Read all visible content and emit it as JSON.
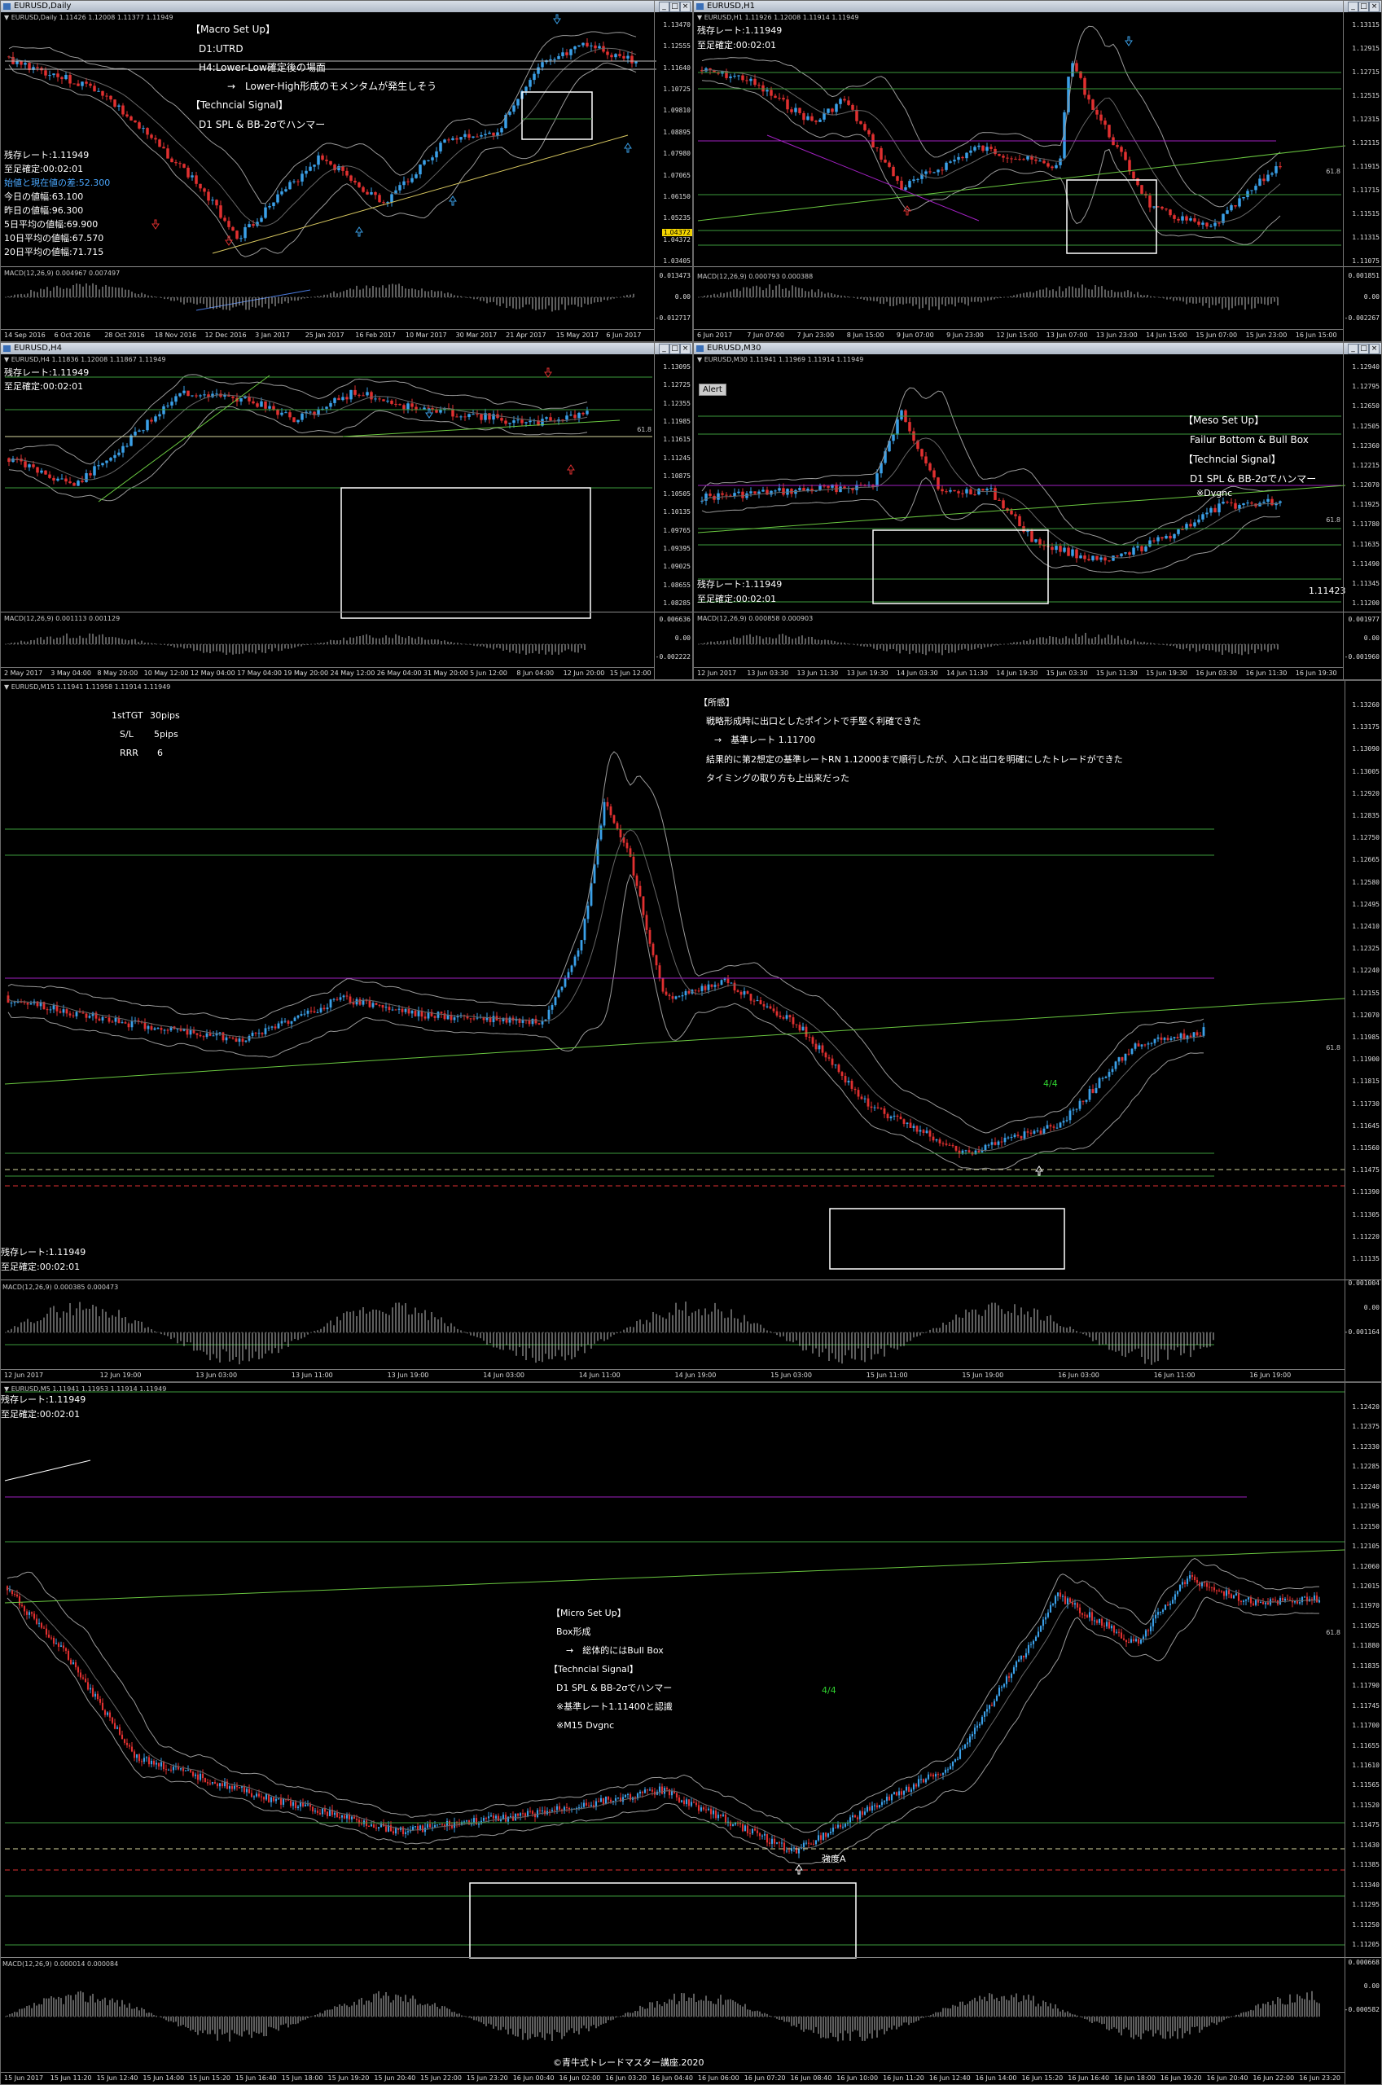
{
  "windows": {
    "daily": {
      "title": "EURUSD,Daily",
      "symbol_line": "▼ EURUSD,Daily  1.11426 1.12008 1.11377 1.11949",
      "annotations": [
        "【Macro Set Up】",
        "D1:UTRD",
        "H4:Lower-Low確定後の場面",
        "→　Lower-High形成のモメンタムが発生しそう",
        "【Techncial Signal】",
        "D1 SPL & BB-2σでハンマー"
      ],
      "info": [
        "残存レート:1.11949",
        "至足確定:00:02:01",
        "始値と現在値の差:52.300",
        "今日の値幅:63.100",
        "昨日の値幅:96.300",
        "5日平均の値幅:69.900",
        "10日平均の値幅:67.570",
        "20日平均の値幅:71.715"
      ],
      "macd_label": "MACD(12,26,9) 0.004967 0.007497",
      "price_ticks": [
        "1.13470",
        "1.12555",
        "1.11640",
        "1.10725",
        "1.09810",
        "1.08895",
        "1.07980",
        "1.07065",
        "1.06150",
        "1.05235",
        "1.04372",
        "1.03405"
      ],
      "price_badge": "1.04372",
      "macd_ticks": [
        "0.013473",
        "0.00",
        "-0.012717"
      ],
      "x_ticks": [
        "14 Sep 2016",
        "6 Oct 2016",
        "28 Oct 2016",
        "18 Nov 2016",
        "12 Dec 2016",
        "3 Jan 2017",
        "25 Jan 2017",
        "16 Feb 2017",
        "10 Mar 2017",
        "30 Mar 2017",
        "21 Apr 2017",
        "15 May 2017",
        "6 Jun 2017"
      ]
    },
    "h1": {
      "title": "EURUSD,H1",
      "symbol_line": "▼ EURUSD,H1  1.11926 1.12008 1.11914 1.11949",
      "info": [
        "残存レート:1.11949",
        "至足確定:00:02:01"
      ],
      "macd_label": "MACD(12,26,9) 0.000793 0.000388",
      "price_ticks": [
        "1.13115",
        "1.12915",
        "1.12715",
        "1.12515",
        "1.12315",
        "1.12115",
        "1.11915",
        "1.11715",
        "1.11515",
        "1.11315",
        "1.11075"
      ],
      "fib_label": "61.8",
      "macd_ticks": [
        "0.001851",
        "0.00",
        "-0.002267"
      ],
      "x_ticks": [
        "6 Jun 2017",
        "7 Jun 07:00",
        "7 Jun 23:00",
        "8 Jun 15:00",
        "9 Jun 07:00",
        "9 Jun 23:00",
        "12 Jun 15:00",
        "13 Jun 07:00",
        "13 Jun 23:00",
        "14 Jun 15:00",
        "15 Jun 07:00",
        "15 Jun 23:00",
        "16 Jun 15:00"
      ]
    },
    "h4": {
      "title": "EURUSD,H4",
      "symbol_line": "▼ EURUSD,H4  1.11836 1.12008 1.11867 1.11949",
      "info": [
        "残存レート:1.11949",
        "至足確定:00:02:01"
      ],
      "macd_label": "MACD(12,26,9) 0.001113 0.001129",
      "price_ticks": [
        "1.13095",
        "1.12725",
        "1.12355",
        "1.11985",
        "1.11615",
        "1.11245",
        "1.10875",
        "1.10505",
        "1.10135",
        "1.09765",
        "1.09395",
        "1.09025",
        "1.08655",
        "1.08285"
      ],
      "fib_label": "61.8",
      "macd_ticks": [
        "0.006636",
        "0.00",
        "-0.002222"
      ],
      "x_ticks": [
        "2 May 2017",
        "3 May 04:00",
        "8 May 20:00",
        "10 May 12:00",
        "12 May 04:00",
        "17 May 04:00",
        "19 May 20:00",
        "24 May 12:00",
        "26 May 04:00",
        "31 May 20:00",
        "5 Jun 12:00",
        "8 Jun 04:00",
        "12 Jun 20:00",
        "15 Jun 12:00"
      ]
    },
    "m30": {
      "title": "EURUSD,M30",
      "symbol_line": "▼ EURUSD,M30  1.11941 1.11969 1.11914 1.11949",
      "alert": "Alert",
      "annotations": [
        "【Meso Set Up】",
        "Failur Bottom & Bull Box",
        "【Techncial Signal】",
        "D1 SPL & BB-2σでハンマー",
        "※Dvgnc"
      ],
      "info": [
        "残存レート:1.11949",
        "至足確定:00:02:01"
      ],
      "price_marker": "1.11423",
      "macd_label": "MACD(12,26,9) 0.000858 0.000903",
      "price_ticks": [
        "1.12940",
        "1.12795",
        "1.12650",
        "1.12505",
        "1.12360",
        "1.12215",
        "1.12070",
        "1.11925",
        "1.11780",
        "1.11635",
        "1.11490",
        "1.11345",
        "1.11200"
      ],
      "fib_label": "61.8",
      "macd_ticks": [
        "0.001977",
        "0.00",
        "-0.001960"
      ],
      "x_ticks": [
        "12 Jun 2017",
        "13 Jun 03:30",
        "13 Jun 11:30",
        "13 Jun 19:30",
        "14 Jun 03:30",
        "14 Jun 11:30",
        "14 Jun 19:30",
        "15 Jun 03:30",
        "15 Jun 11:30",
        "15 Jun 19:30",
        "16 Jun 03:30",
        "16 Jun 11:30",
        "16 Jun 19:30"
      ]
    },
    "m15": {
      "symbol_line": "▼ EURUSD,M15  1.11941 1.11958 1.11914 1.11949",
      "tgt": [
        "1stTGT",
        "30pips"
      ],
      "sl": [
        "S/L",
        "5pips"
      ],
      "rrr": [
        "RRR",
        "6"
      ],
      "impressions": [
        "【所感】",
        "戦略形成時に出口としたポイントで手堅く利確できた",
        "→　基準レート 1.11700",
        "結果的に第2想定の基準レートRN 1.12000まで順行したが、入口と出口を明確にしたトレードができた",
        "タイミングの取り方も上出来だった"
      ],
      "count_label": "4/4",
      "info": [
        "残存レート:1.11949",
        "至足確定:00:02:01"
      ],
      "macd_label": "MACD(12,26,9) 0.000385 0.000473",
      "price_ticks": [
        "1.13260",
        "1.13175",
        "1.13090",
        "1.13005",
        "1.12920",
        "1.12835",
        "1.12750",
        "1.12665",
        "1.12580",
        "1.12495",
        "1.12410",
        "1.12325",
        "1.12240",
        "1.12155",
        "1.12070",
        "1.11985",
        "1.11900",
        "1.11815",
        "1.11730",
        "1.11645",
        "1.11560",
        "1.11475",
        "1.11390",
        "1.11305",
        "1.11220",
        "1.11135"
      ],
      "fib_label": "61.8",
      "macd_ticks": [
        "0.001004",
        "0.00",
        "-0.001164"
      ],
      "x_ticks": [
        "12 Jun 2017",
        "12 Jun 19:00",
        "13 Jun 03:00",
        "13 Jun 11:00",
        "13 Jun 19:00",
        "14 Jun 03:00",
        "14 Jun 11:00",
        "14 Jun 19:00",
        "15 Jun 03:00",
        "15 Jun 11:00",
        "15 Jun 19:00",
        "16 Jun 03:00",
        "16 Jun 11:00",
        "16 Jun 19:00"
      ]
    },
    "m5": {
      "symbol_line": "▼ EURUSD,M5  1.11941 1.11953 1.11914 1.11949",
      "info": [
        "残存レート:1.11949",
        "至足確定:00:02:01"
      ],
      "annotations": [
        "【Micro Set Up】",
        "Box形成",
        "→　総体的にはBull Box",
        "【Techncial Signal】",
        "D1 SPL & BB-2σでハンマー",
        "※基準レート1.11400と認識",
        "※M15 Dvgnc"
      ],
      "count_label": "4/4",
      "strength_label": "強度A",
      "macd_label": "MACD(12,26,9) 0.000014 0.000084",
      "price_ticks": [
        "1.12420",
        "1.12375",
        "1.12330",
        "1.12285",
        "1.12240",
        "1.12195",
        "1.12150",
        "1.12105",
        "1.12060",
        "1.12015",
        "1.11970",
        "1.11925",
        "1.11880",
        "1.11835",
        "1.11790",
        "1.11745",
        "1.11700",
        "1.11655",
        "1.11610",
        "1.11565",
        "1.11520",
        "1.11475",
        "1.11430",
        "1.11385",
        "1.11340",
        "1.11295",
        "1.11250",
        "1.11205"
      ],
      "fib_label": "61.8",
      "macd_ticks": [
        "0.000668",
        "0.00",
        "-0.000582"
      ],
      "x_ticks": [
        "15 Jun 2017",
        "15 Jun 11:20",
        "15 Jun 12:40",
        "15 Jun 14:00",
        "15 Jun 15:20",
        "15 Jun 16:40",
        "15 Jun 18:00",
        "15 Jun 19:20",
        "15 Jun 20:40",
        "15 Jun 22:00",
        "15 Jun 23:20",
        "16 Jun 00:40",
        "16 Jun 02:00",
        "16 Jun 03:20",
        "16 Jun 04:40",
        "16 Jun 06:00",
        "16 Jun 07:20",
        "16 Jun 08:40",
        "16 Jun 10:00",
        "16 Jun 11:20",
        "16 Jun 12:40",
        "16 Jun 14:00",
        "16 Jun 15:20",
        "16 Jun 16:40",
        "16 Jun 18:00",
        "16 Jun 19:20",
        "16 Jun 20:40",
        "16 Jun 22:00",
        "16 Jun 23:20"
      ]
    }
  },
  "copyright": "©青牛式トレードマスター講座.2020",
  "colors": {
    "bull": "#3aa0e8",
    "bear": "#e03030",
    "level": "#3d9a3d",
    "purple": "#a020c0",
    "bollinger": "#9a9a9a",
    "box": "#ffffff"
  }
}
